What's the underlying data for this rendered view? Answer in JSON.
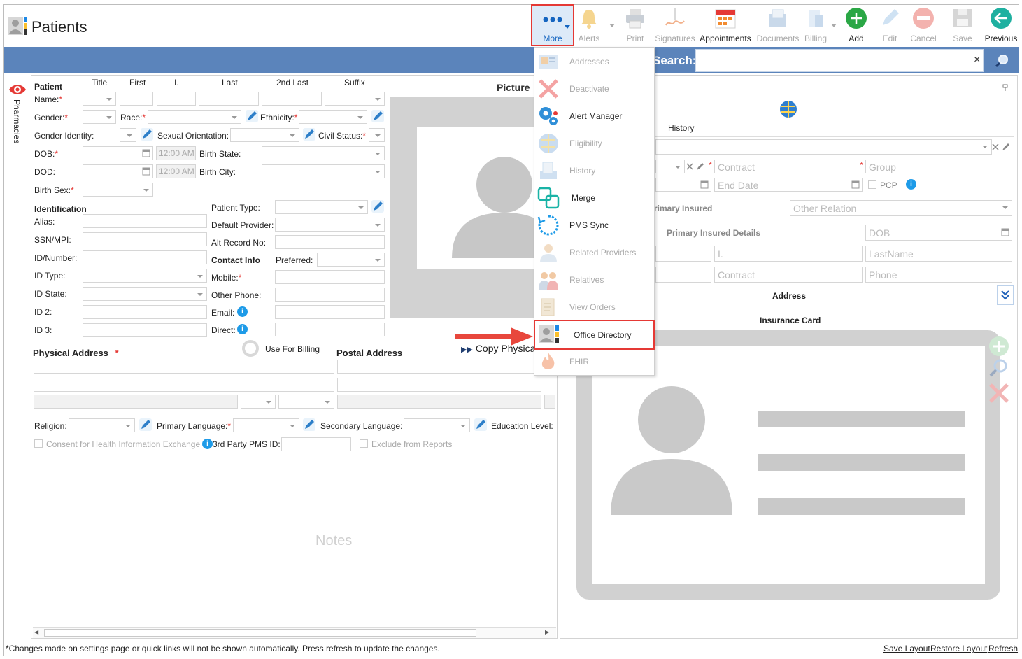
{
  "app": {
    "title": "Patients"
  },
  "toolbar": [
    {
      "id": "more",
      "label": "More",
      "disabled": false
    },
    {
      "id": "alerts",
      "label": "Alerts",
      "disabled": true
    },
    {
      "id": "print",
      "label": "Print",
      "disabled": true
    },
    {
      "id": "signatures",
      "label": "Signatures",
      "disabled": true
    },
    {
      "id": "appointments",
      "label": "Appointments",
      "disabled": false
    },
    {
      "id": "documents",
      "label": "Documents",
      "disabled": true
    },
    {
      "id": "billing",
      "label": "Billing",
      "disabled": true
    },
    {
      "id": "add",
      "label": "Add",
      "disabled": false
    },
    {
      "id": "edit",
      "label": "Edit",
      "disabled": true
    },
    {
      "id": "cancel",
      "label": "Cancel",
      "disabled": true
    },
    {
      "id": "save",
      "label": "Save",
      "disabled": true
    },
    {
      "id": "previous",
      "label": "Previous",
      "disabled": false
    }
  ],
  "search": {
    "label": "Search:",
    "clear": "×"
  },
  "side_tab": {
    "label": "Pharmacies"
  },
  "patient": {
    "section": "Patient",
    "col_title": "Title",
    "col_first": "First",
    "col_i": "I.",
    "col_last": "Last",
    "col_2nd_last": "2nd Last",
    "col_suffix": "Suffix",
    "name": "Name:",
    "gender": "Gender:",
    "race": "Race:",
    "ethnicity": "Ethnicity:",
    "gender_identity": "Gender Identity:",
    "sexual_orientation": "Sexual Orientation:",
    "civil_status": "Civil Status:",
    "dob": "DOB:",
    "dod": "DOD:",
    "birth_state": "Birth State:",
    "birth_city": "Birth City:",
    "birth_sex": "Birth Sex:",
    "time_placeholder": "12:00 AM",
    "picture": "Picture"
  },
  "identification": {
    "section": "Identification",
    "alias": "Alias:",
    "ssn": "SSN/MPI:",
    "id_number": "ID/Number:",
    "id_type": "ID Type:",
    "id_state": "ID State:",
    "id2": "ID 2:",
    "id3": "ID 3:",
    "patient_type": "Patient Type:",
    "default_provider": "Default Provider:",
    "alt_record": "Alt Record No:",
    "contact_info": "Contact Info",
    "preferred": "Preferred:",
    "mobile": "Mobile:",
    "other_phone": "Other Phone:",
    "email": "Email:",
    "direct": "Direct:"
  },
  "address": {
    "physical": "Physical Address",
    "use_billing": "Use For Billing",
    "postal": "Postal Address",
    "copy": "Copy Physica"
  },
  "misc": {
    "religion": "Religion:",
    "primary_language": "Primary Language:",
    "secondary_language": "Secondary Language:",
    "education": "Education Level:",
    "consent": "Consent for Health Information Exchange",
    "third_party": "3rd Party PMS ID:",
    "exclude": "Exclude from Reports",
    "notes_placeholder": "Notes"
  },
  "insurance": {
    "history_tab": "History",
    "contract": "Contract",
    "group": "Group",
    "end_date": "End Date",
    "pcp": "PCP",
    "primary_insured": "rimary Insured",
    "other_relation": "Other Relation",
    "primary_insured_details": "Primary Insured Details",
    "dob": "DOB",
    "i": "I.",
    "last_name": "LastName",
    "contract2": "Contract",
    "phone": "Phone",
    "address": "Address",
    "insurance_card": "Insurance Card"
  },
  "more_menu": [
    {
      "label": "Addresses",
      "disabled": true,
      "icon": "address-book-icon"
    },
    {
      "label": "Deactivate",
      "disabled": true,
      "icon": "x-icon"
    },
    {
      "label": "Alert Manager",
      "disabled": false,
      "icon": "gears-icon"
    },
    {
      "label": "Eligibility",
      "disabled": true,
      "icon": "eligibility-icon"
    },
    {
      "label": "History",
      "disabled": true,
      "icon": "history-icon"
    },
    {
      "label": "Merge",
      "disabled": false,
      "icon": "merge-icon"
    },
    {
      "label": "PMS Sync",
      "disabled": false,
      "icon": "sync-icon"
    },
    {
      "label": "Related Providers",
      "disabled": true,
      "icon": "related-providers-icon"
    },
    {
      "label": "Relatives",
      "disabled": true,
      "icon": "relatives-icon"
    },
    {
      "label": "View Orders",
      "disabled": true,
      "icon": "orders-icon"
    },
    {
      "label": "Office Directory",
      "disabled": false,
      "icon": "office-directory-icon",
      "highlighted": true
    },
    {
      "label": "FHIR",
      "disabled": true,
      "icon": "fhir-icon"
    }
  ],
  "footer": {
    "note": "*Changes made on settings page or quick links will not be shown automatically. Press refresh to update the changes.",
    "save_layout": "Save Layout",
    "restore_layout": "Restore Layout",
    "refresh": "Refresh"
  },
  "colors": {
    "accent_bar": "#5b84bb",
    "highlight": "#e53935",
    "info": "#1e9be8",
    "add": "#2aa745",
    "previous": "#1fb0a0"
  }
}
